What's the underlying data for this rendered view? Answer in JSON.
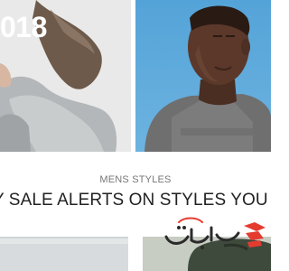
{
  "hero": {
    "left": {
      "year_text": "018",
      "image": "woman-athletic-jacket-photo"
    },
    "right": {
      "image": "man-grey-tshirt-photo"
    }
  },
  "section": {
    "heading": "MENS STYLES",
    "tagline": "Y SALE ALERTS ON STYLES YOU L"
  },
  "bottom_cards": [
    {
      "image": "product-photo-left"
    },
    {
      "image": "product-photo-right"
    }
  ],
  "watermark": {
    "name": "persian-logo-watermark",
    "colors": {
      "red": "#e53b2f",
      "dark": "#2b2b2b"
    }
  },
  "colors": {
    "hero_right_bg": "#5aa7da",
    "hero_left_bg": "#e8e8e8",
    "heading": "#777777",
    "tagline": "#222222"
  }
}
